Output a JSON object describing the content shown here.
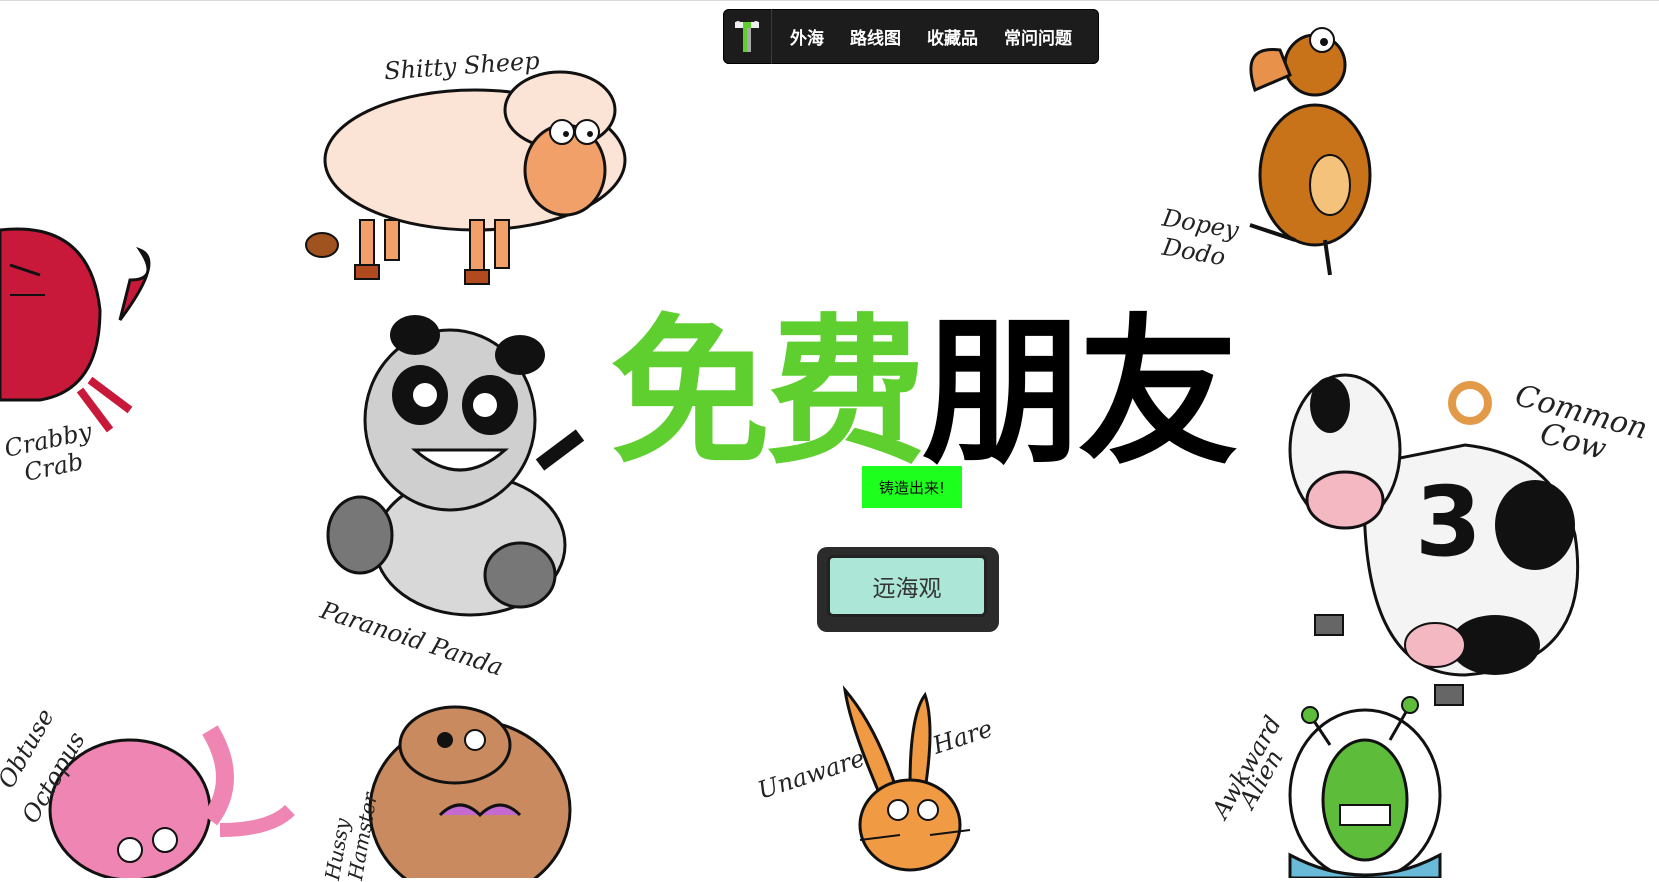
{
  "nav": {
    "links": [
      "外海",
      "路线图",
      "收藏品",
      "常问问题"
    ]
  },
  "hero": {
    "title_green": "免费",
    "title_black": "朋友",
    "badge": "铸造出来!",
    "cta": "远海观"
  },
  "animals": {
    "sheep": "Shitty Sheep",
    "dodo_1": "Dopey",
    "dodo_2": "Dodo",
    "crab_1": "Crabby",
    "crab_2": "Crab",
    "panda": "Paranoid Panda",
    "cow_1": "Common",
    "cow_2": "Cow",
    "cow_number": "3",
    "octopus_1": "Obtuse",
    "octopus_2": "Octopus",
    "hamster_1": "Hussy",
    "hamster_2": "Hamster",
    "hare_1": "Unaware",
    "hare_2": "Hare",
    "alien_1": "Awkward",
    "alien_2": "Alien"
  },
  "colors": {
    "green": "#5fcf2f",
    "badge": "#1dff1d",
    "cta": "#abe6d6",
    "nav": "#1c1c1c"
  }
}
